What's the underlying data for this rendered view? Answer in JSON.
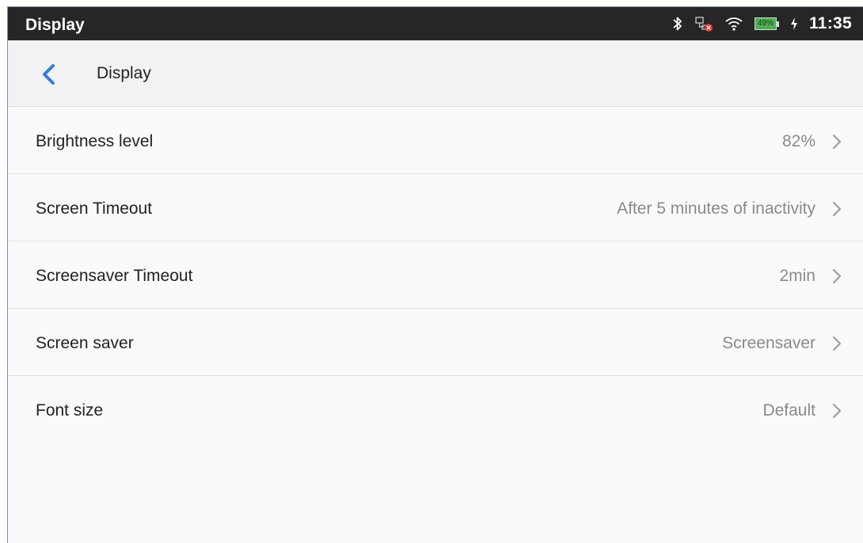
{
  "status_bar": {
    "app_name": "Display",
    "battery_percent": "49%",
    "time": "11:35",
    "icons": [
      "bluetooth-icon",
      "network-disconnected-icon",
      "wifi-icon",
      "battery-icon",
      "charging-icon"
    ]
  },
  "header": {
    "back_icon": "chevron-left-icon",
    "title": "Display"
  },
  "settings": [
    {
      "label": "Brightness level",
      "value": "82%"
    },
    {
      "label": "Screen Timeout",
      "value": "After 5 minutes of inactivity"
    },
    {
      "label": "Screensaver Timeout",
      "value": "2min"
    },
    {
      "label": "Screen saver",
      "value": "Screensaver"
    },
    {
      "label": "Font size",
      "value": "Default"
    }
  ],
  "colors": {
    "status_bar_bg": "#262626",
    "accent": "#2f7ee0",
    "battery_fill": "#4caf50",
    "error_badge": "#e53935"
  }
}
